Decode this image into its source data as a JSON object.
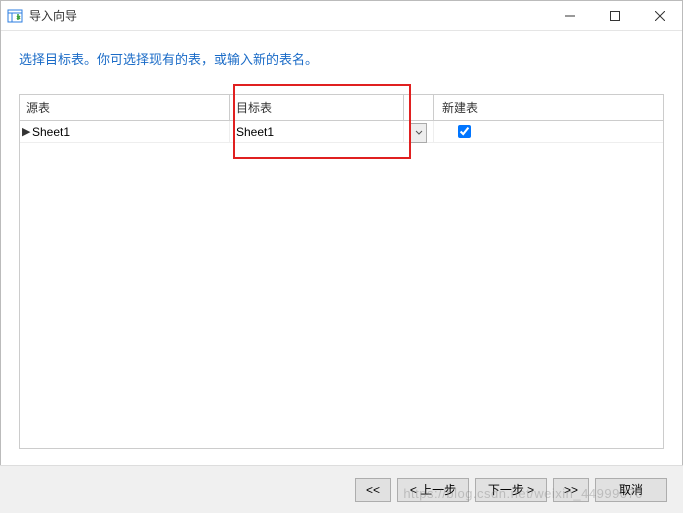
{
  "window": {
    "title": "导入向导"
  },
  "instruction": "选择目标表。你可选择现有的表，或输入新的表名。",
  "grid": {
    "headers": {
      "source": "源表",
      "target": "目标表",
      "new": "新建表"
    },
    "rows": [
      {
        "source": "Sheet1",
        "target": "Sheet1",
        "new_checked": true
      }
    ]
  },
  "footer": {
    "first": "<<",
    "prev": "< 上一步",
    "next": "下一步 >",
    "last": ">>",
    "cancel": "取消"
  },
  "watermark": "https://blog.csdn.net/weixin_44999070"
}
